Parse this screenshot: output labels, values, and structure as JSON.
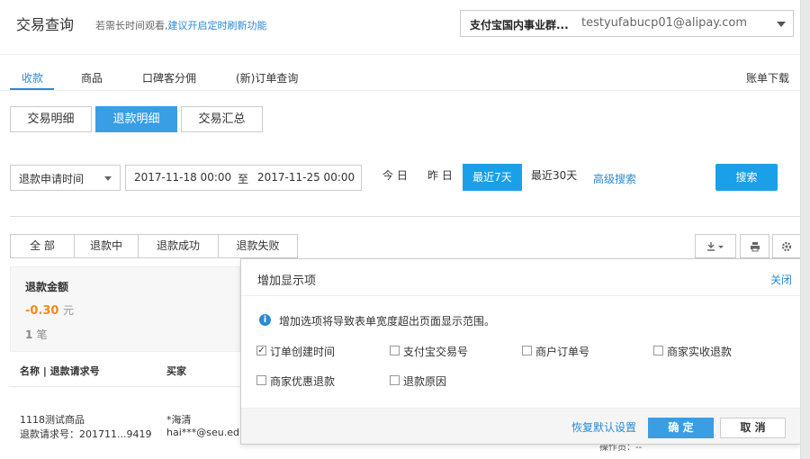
{
  "header": {
    "title": "交易查询",
    "hint_prefix": "若需长时间观看,",
    "hint_link": "建议开启定时刷新功能",
    "account_org": "支付宝国内事业群...",
    "account_email": "testyufabucp01@alipay.com"
  },
  "mainnav": {
    "items": [
      "收款",
      "商品",
      "口碑客分佣",
      "(新)订单查询"
    ],
    "active": "收款",
    "bill_download": "账单下载"
  },
  "segments": {
    "items": [
      "交易明细",
      "退款明细",
      "交易汇总"
    ],
    "active": "退款明细"
  },
  "filters": {
    "date_type": "退款申请时间",
    "start": "2017-11-18 00:00",
    "to": "至",
    "end": "2017-11-25 00:00",
    "quick": [
      "今 日",
      "昨 日",
      "最近7天",
      "最近30天"
    ],
    "quick_active": "最近7天",
    "advanced": "高级搜索",
    "search": "搜索"
  },
  "status_tabs": [
    "全 部",
    "退款中",
    "退款成功",
    "退款失败"
  ],
  "summary": {
    "label": "退款金额",
    "amount": "-0.30",
    "unit": "元",
    "count": "1",
    "count_unit": "笔"
  },
  "table": {
    "headers": [
      "名称 | 退款请求号",
      "买家"
    ],
    "row": {
      "name": "1118测试商品",
      "refund_no": "退款请求号：201711...9419",
      "buyer_name": "*海清",
      "buyer_account": "hai***@seu.edu.",
      "operator": "操作员：--"
    }
  },
  "dialog": {
    "title": "增加显示项",
    "close": "关闭",
    "info_icon": "info-icon",
    "info": "增加选项将导致表单宽度超出页面显示范围。",
    "options": [
      {
        "label": "订单创建时间",
        "checked": true
      },
      {
        "label": "支付宝交易号",
        "checked": false
      },
      {
        "label": "商户订单号",
        "checked": false
      },
      {
        "label": "商家实收退款",
        "checked": false
      },
      {
        "label": "商家优惠退款",
        "checked": false
      },
      {
        "label": "退款原因",
        "checked": false
      }
    ],
    "restore": "恢复默认设置",
    "ok": "确 定",
    "cancel": "取 消"
  },
  "colors": {
    "accent": "#1aa0e8",
    "link": "#2a8ad4",
    "amount": "#f08a1e"
  }
}
